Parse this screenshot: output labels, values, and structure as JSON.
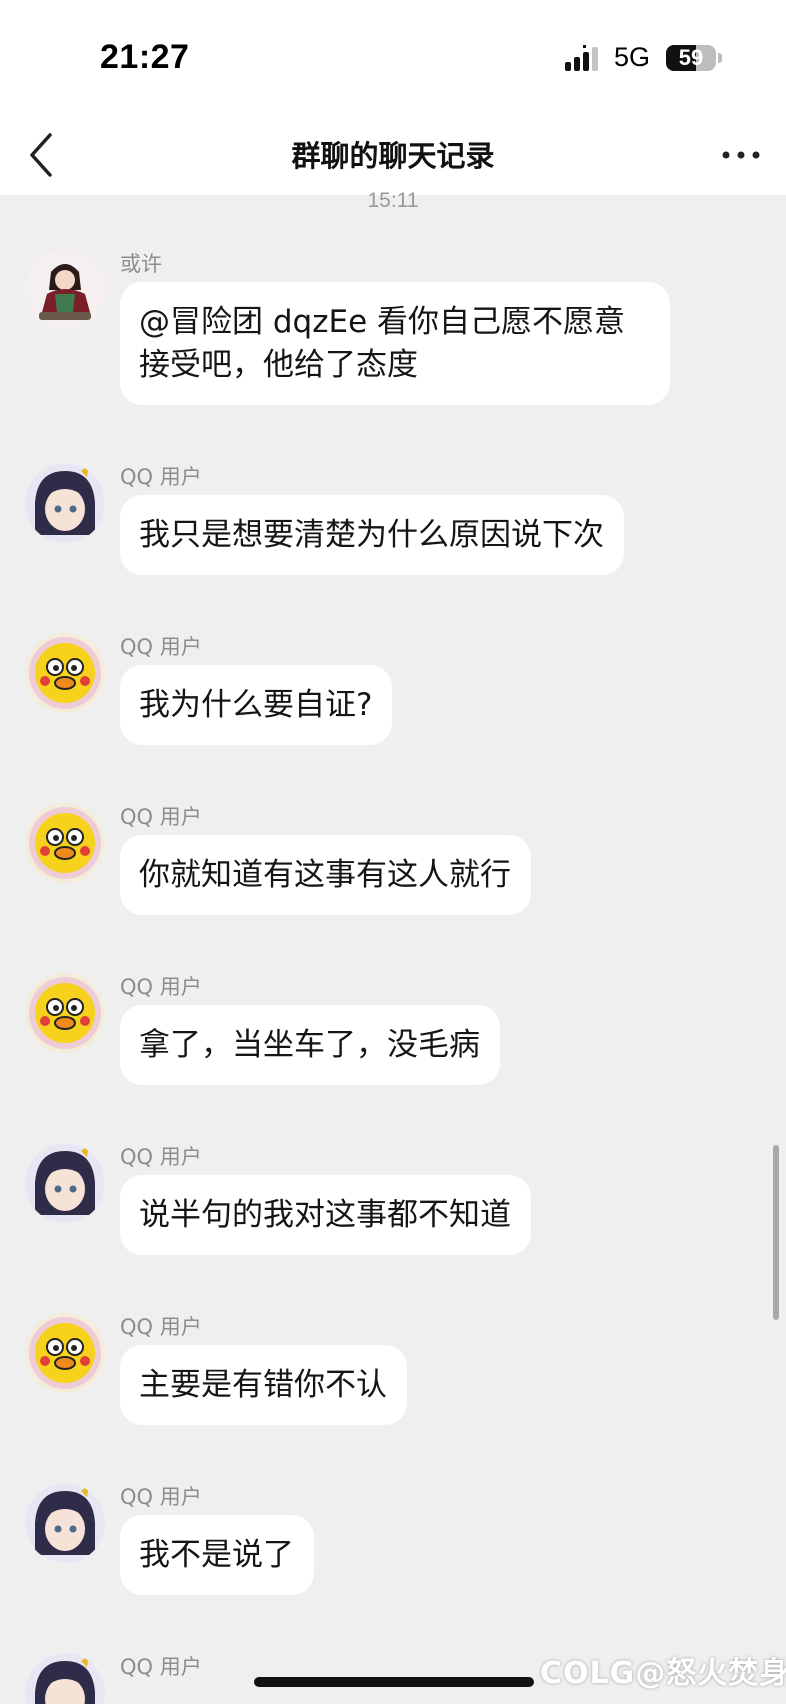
{
  "status_bar": {
    "time": "21:27",
    "network": "5G",
    "battery": "59",
    "battery_level": 0.59
  },
  "nav": {
    "title": "群聊的聊天记录",
    "back_icon": "chevron-left-icon",
    "more_icon": "more-horizontal-icon"
  },
  "timestamp": "15:11",
  "messages": [
    {
      "sender": "或许",
      "text": "@冒险团 dqzEe 看你自己愿不愿意接受吧，他给了态度",
      "avatar": "avatar-girl-kimono"
    },
    {
      "sender": "QQ 用户",
      "text": "我只是想要清楚为什么原因说下次",
      "avatar": "avatar-anime-girl"
    },
    {
      "sender": "QQ 用户",
      "text": "我为什么要自证?",
      "avatar": "avatar-yellow-duck"
    },
    {
      "sender": "QQ 用户",
      "text": "你就知道有这事有这人就行",
      "avatar": "avatar-yellow-duck"
    },
    {
      "sender": "QQ 用户",
      "text": "拿了，当坐车了，没毛病",
      "avatar": "avatar-yellow-duck"
    },
    {
      "sender": "QQ 用户",
      "text": "说半句的我对这事都不知道",
      "avatar": "avatar-anime-girl"
    },
    {
      "sender": "QQ 用户",
      "text": "主要是有错你不认",
      "avatar": "avatar-yellow-duck"
    },
    {
      "sender": "QQ 用户",
      "text": "我不是说了",
      "avatar": "avatar-anime-girl"
    },
    {
      "sender": "QQ 用户",
      "text": "",
      "avatar": "avatar-anime-girl"
    }
  ],
  "watermark": "COLG@怒火焚身",
  "colors": {
    "background": "#efefef",
    "bubble": "#ffffff",
    "header": "#ffffff",
    "sender_text": "#8d8d8d"
  }
}
